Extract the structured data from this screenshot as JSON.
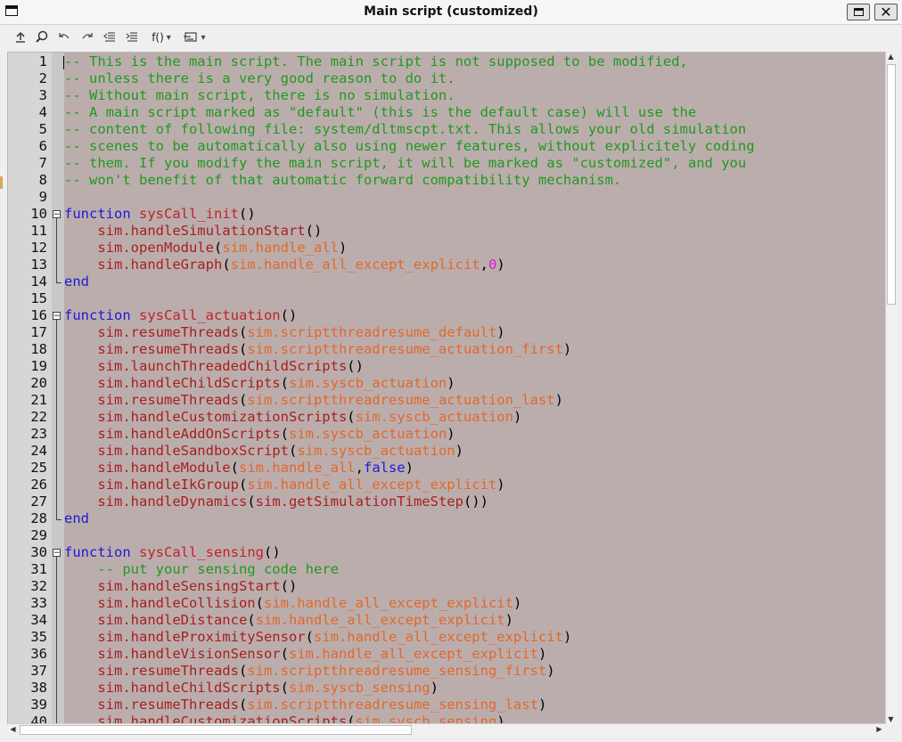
{
  "window": {
    "title": "Main script (customized)",
    "maximize_label": "",
    "close_label": "✕"
  },
  "toolbar": {
    "function_menu_label": "f()",
    "dropdown_glyph": "▾"
  },
  "editor": {
    "visible_lines": [
      {
        "n": "1",
        "tokens": [
          [
            "comment",
            "-- This is the main script. The main script is not supposed to be modified,"
          ]
        ]
      },
      {
        "n": "2",
        "tokens": [
          [
            "comment",
            "-- unless there is a very good reason to do it."
          ]
        ]
      },
      {
        "n": "3",
        "tokens": [
          [
            "comment",
            "-- Without main script, there is no simulation."
          ]
        ]
      },
      {
        "n": "4",
        "tokens": [
          [
            "comment",
            "-- A main script marked as \"default\" (this is the default case) will use the"
          ]
        ]
      },
      {
        "n": "5",
        "tokens": [
          [
            "comment",
            "-- content of following file: system/dltmscpt.txt. This allows your old simulation"
          ]
        ]
      },
      {
        "n": "6",
        "tokens": [
          [
            "comment",
            "-- scenes to be automatically also using newer features, without explicitely coding"
          ]
        ]
      },
      {
        "n": "7",
        "tokens": [
          [
            "comment",
            "-- them. If you modify the main script, it will be marked as \"customized\", and you"
          ]
        ]
      },
      {
        "n": "8",
        "tokens": [
          [
            "comment",
            "-- won't benefit of that automatic forward compatibility mechanism."
          ]
        ]
      },
      {
        "n": "9",
        "tokens": []
      },
      {
        "n": "10",
        "tokens": [
          [
            "kw",
            "function "
          ],
          [
            "fn",
            "sysCall_init"
          ],
          [
            "plain",
            "()"
          ]
        ]
      },
      {
        "n": "11",
        "tokens": [
          [
            "plain",
            "    "
          ],
          [
            "api",
            "sim.handleSimulationStart"
          ],
          [
            "plain",
            "()"
          ]
        ]
      },
      {
        "n": "12",
        "tokens": [
          [
            "plain",
            "    "
          ],
          [
            "api",
            "sim.openModule"
          ],
          [
            "plain",
            "("
          ],
          [
            "const",
            "sim.handle_all"
          ],
          [
            "plain",
            ")"
          ]
        ]
      },
      {
        "n": "13",
        "tokens": [
          [
            "plain",
            "    "
          ],
          [
            "api",
            "sim.handleGraph"
          ],
          [
            "plain",
            "("
          ],
          [
            "const",
            "sim.handle_all_except_explicit"
          ],
          [
            "plain",
            ","
          ],
          [
            "num",
            "0"
          ],
          [
            "plain",
            ")"
          ]
        ]
      },
      {
        "n": "14",
        "tokens": [
          [
            "kw",
            "end"
          ]
        ]
      },
      {
        "n": "15",
        "tokens": []
      },
      {
        "n": "16",
        "tokens": [
          [
            "kw",
            "function "
          ],
          [
            "fn",
            "sysCall_actuation"
          ],
          [
            "plain",
            "()"
          ]
        ]
      },
      {
        "n": "17",
        "tokens": [
          [
            "plain",
            "    "
          ],
          [
            "api",
            "sim.resumeThreads"
          ],
          [
            "plain",
            "("
          ],
          [
            "const",
            "sim.scriptthreadresume_default"
          ],
          [
            "plain",
            ")"
          ]
        ]
      },
      {
        "n": "18",
        "tokens": [
          [
            "plain",
            "    "
          ],
          [
            "api",
            "sim.resumeThreads"
          ],
          [
            "plain",
            "("
          ],
          [
            "const",
            "sim.scriptthreadresume_actuation_first"
          ],
          [
            "plain",
            ")"
          ]
        ]
      },
      {
        "n": "19",
        "tokens": [
          [
            "plain",
            "    "
          ],
          [
            "api",
            "sim.launchThreadedChildScripts"
          ],
          [
            "plain",
            "()"
          ]
        ]
      },
      {
        "n": "20",
        "tokens": [
          [
            "plain",
            "    "
          ],
          [
            "api",
            "sim.handleChildScripts"
          ],
          [
            "plain",
            "("
          ],
          [
            "const",
            "sim.syscb_actuation"
          ],
          [
            "plain",
            ")"
          ]
        ]
      },
      {
        "n": "21",
        "tokens": [
          [
            "plain",
            "    "
          ],
          [
            "api",
            "sim.resumeThreads"
          ],
          [
            "plain",
            "("
          ],
          [
            "const",
            "sim.scriptthreadresume_actuation_last"
          ],
          [
            "plain",
            ")"
          ]
        ]
      },
      {
        "n": "22",
        "tokens": [
          [
            "plain",
            "    "
          ],
          [
            "api",
            "sim.handleCustomizationScripts"
          ],
          [
            "plain",
            "("
          ],
          [
            "const",
            "sim.syscb_actuation"
          ],
          [
            "plain",
            ")"
          ]
        ]
      },
      {
        "n": "23",
        "tokens": [
          [
            "plain",
            "    "
          ],
          [
            "api",
            "sim.handleAddOnScripts"
          ],
          [
            "plain",
            "("
          ],
          [
            "const",
            "sim.syscb_actuation"
          ],
          [
            "plain",
            ")"
          ]
        ]
      },
      {
        "n": "24",
        "tokens": [
          [
            "plain",
            "    "
          ],
          [
            "api",
            "sim.handleSandboxScript"
          ],
          [
            "plain",
            "("
          ],
          [
            "const",
            "sim.syscb_actuation"
          ],
          [
            "plain",
            ")"
          ]
        ]
      },
      {
        "n": "25",
        "tokens": [
          [
            "plain",
            "    "
          ],
          [
            "api",
            "sim.handleModule"
          ],
          [
            "plain",
            "("
          ],
          [
            "const",
            "sim.handle_all"
          ],
          [
            "plain",
            ","
          ],
          [
            "kw",
            "false"
          ],
          [
            "plain",
            ")"
          ]
        ]
      },
      {
        "n": "26",
        "tokens": [
          [
            "plain",
            "    "
          ],
          [
            "api",
            "sim.handleIkGroup"
          ],
          [
            "plain",
            "("
          ],
          [
            "const",
            "sim.handle_all_except_explicit"
          ],
          [
            "plain",
            ")"
          ]
        ]
      },
      {
        "n": "27",
        "tokens": [
          [
            "plain",
            "    "
          ],
          [
            "api",
            "sim.handleDynamics"
          ],
          [
            "plain",
            "("
          ],
          [
            "api",
            "sim.getSimulationTimeStep"
          ],
          [
            "plain",
            "())"
          ]
        ]
      },
      {
        "n": "28",
        "tokens": [
          [
            "kw",
            "end"
          ]
        ]
      },
      {
        "n": "29",
        "tokens": []
      },
      {
        "n": "30",
        "tokens": [
          [
            "kw",
            "function "
          ],
          [
            "fn",
            "sysCall_sensing"
          ],
          [
            "plain",
            "()"
          ]
        ]
      },
      {
        "n": "31",
        "tokens": [
          [
            "plain",
            "    "
          ],
          [
            "comment",
            "-- put your sensing code here"
          ]
        ]
      },
      {
        "n": "32",
        "tokens": [
          [
            "plain",
            "    "
          ],
          [
            "api",
            "sim.handleSensingStart"
          ],
          [
            "plain",
            "()"
          ]
        ]
      },
      {
        "n": "33",
        "tokens": [
          [
            "plain",
            "    "
          ],
          [
            "api",
            "sim.handleCollision"
          ],
          [
            "plain",
            "("
          ],
          [
            "const",
            "sim.handle_all_except_explicit"
          ],
          [
            "plain",
            ")"
          ]
        ]
      },
      {
        "n": "34",
        "tokens": [
          [
            "plain",
            "    "
          ],
          [
            "api",
            "sim.handleDistance"
          ],
          [
            "plain",
            "("
          ],
          [
            "const",
            "sim.handle_all_except_explicit"
          ],
          [
            "plain",
            ")"
          ]
        ]
      },
      {
        "n": "35",
        "tokens": [
          [
            "plain",
            "    "
          ],
          [
            "api",
            "sim.handleProximitySensor"
          ],
          [
            "plain",
            "("
          ],
          [
            "const",
            "sim.handle_all_except_explicit"
          ],
          [
            "plain",
            ")"
          ]
        ]
      },
      {
        "n": "36",
        "tokens": [
          [
            "plain",
            "    "
          ],
          [
            "api",
            "sim.handleVisionSensor"
          ],
          [
            "plain",
            "("
          ],
          [
            "const",
            "sim.handle_all_except_explicit"
          ],
          [
            "plain",
            ")"
          ]
        ]
      },
      {
        "n": "37",
        "tokens": [
          [
            "plain",
            "    "
          ],
          [
            "api",
            "sim.resumeThreads"
          ],
          [
            "plain",
            "("
          ],
          [
            "const",
            "sim.scriptthreadresume_sensing_first"
          ],
          [
            "plain",
            ")"
          ]
        ]
      },
      {
        "n": "38",
        "tokens": [
          [
            "plain",
            "    "
          ],
          [
            "api",
            "sim.handleChildScripts"
          ],
          [
            "plain",
            "("
          ],
          [
            "const",
            "sim.syscb_sensing"
          ],
          [
            "plain",
            ")"
          ]
        ]
      },
      {
        "n": "39",
        "tokens": [
          [
            "plain",
            "    "
          ],
          [
            "api",
            "sim.resumeThreads"
          ],
          [
            "plain",
            "("
          ],
          [
            "const",
            "sim.scriptthreadresume_sensing_last"
          ],
          [
            "plain",
            ")"
          ]
        ]
      },
      {
        "n": "40",
        "tokens": [
          [
            "plain",
            "    "
          ],
          [
            "api",
            "sim.handleCustomizationScripts"
          ],
          [
            "plain",
            "("
          ],
          [
            "const",
            "sim.syscb_sensing"
          ],
          [
            "plain",
            ")"
          ]
        ]
      }
    ],
    "fold_markers": [
      "10",
      "16",
      "30"
    ],
    "fold_ends": [
      "14",
      "28"
    ]
  },
  "colors": {
    "editor_background": "#bcadad",
    "comment": "#1e9a1e",
    "keyword": "#1b1bd6",
    "function_name": "#c0212a",
    "api_call": "#a61f1f",
    "constant": "#e0692a",
    "number": "#d01ed0"
  },
  "icons": [
    "upload-icon",
    "search-icon",
    "undo-icon",
    "redo-icon",
    "outdent-icon",
    "indent-icon",
    "function-list-icon",
    "snippet-icon"
  ]
}
